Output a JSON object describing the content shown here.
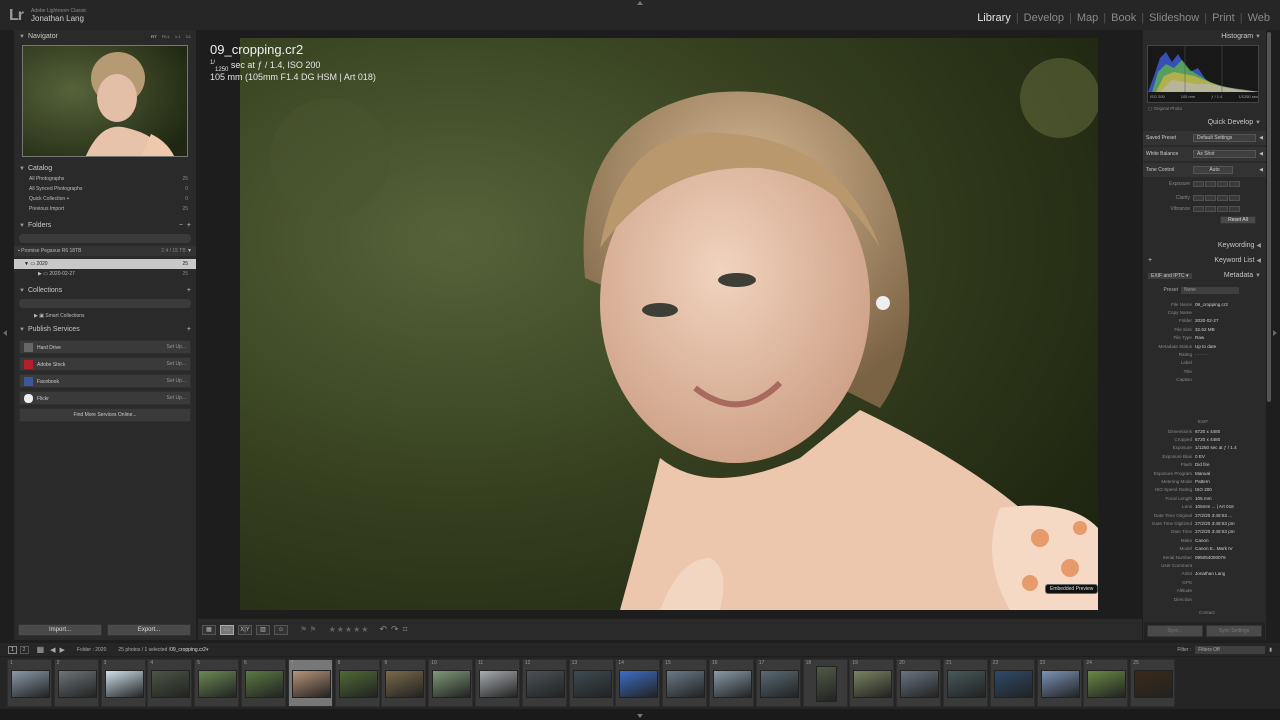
{
  "app": {
    "logo": "Lr",
    "product": "Adobe Lightroom Classic",
    "user": "Jonathan Lang"
  },
  "modules": [
    {
      "label": "Library",
      "active": true
    },
    {
      "label": "Develop",
      "active": false
    },
    {
      "label": "Map",
      "active": false
    },
    {
      "label": "Book",
      "active": false
    },
    {
      "label": "Slideshow",
      "active": false
    },
    {
      "label": "Print",
      "active": false
    },
    {
      "label": "Web",
      "active": false
    }
  ],
  "navigator": {
    "title": "Navigator",
    "modes": [
      "FIT",
      "FILL",
      "1:1",
      "3:1"
    ]
  },
  "catalog": {
    "title": "Catalog",
    "items": [
      {
        "label": "All Photographs",
        "count": "25"
      },
      {
        "label": "All Synced Photographs",
        "count": "0"
      },
      {
        "label": "Quick Collection +",
        "count": "0"
      },
      {
        "label": "Previous Import",
        "count": "25"
      }
    ]
  },
  "folders": {
    "title": "Folders",
    "volume": "Promise Pegasus R6 18TB",
    "volume_size": "2.4 / 15 TB",
    "items": [
      {
        "label": "2020",
        "count": "25"
      },
      {
        "label": "2020-02-27",
        "count": "25"
      }
    ]
  },
  "collections": {
    "title": "Collections",
    "items": [
      {
        "label": "Smart Collections"
      }
    ]
  },
  "publish": {
    "title": "Publish Services",
    "items": [
      {
        "label": "Hard Drive",
        "action": "Set Up..."
      },
      {
        "label": "Adobe Stock",
        "action": "Set Up..."
      },
      {
        "label": "Facebook",
        "action": "Set Up..."
      },
      {
        "label": "Flickr",
        "action": "Set Up..."
      }
    ],
    "find_more": "Find More Services Online..."
  },
  "buttons": {
    "import": "Import...",
    "export": "Export..."
  },
  "photo": {
    "filename": "09_cropping.cr2",
    "shutter_prefix": "1/",
    "shutter_den": "1250",
    "exposure_rest": " sec at ƒ / 1.4, ISO 200",
    "lens_line": "105 mm (105mm F1.4 DG HSM | Art 018)",
    "preview_badge": "Embedded Preview"
  },
  "histogram": {
    "title": "Histogram",
    "iso": "ISO 200",
    "focal": "105 mm",
    "aperture": "ƒ / 1.4",
    "shutter": "1/1250 sec",
    "original": "Original Photo"
  },
  "quick_develop": {
    "title": "Quick Develop",
    "saved_preset_label": "Saved Preset",
    "saved_preset_value": "Default Settings",
    "wb_label": "White Balance",
    "wb_value": "As Shot",
    "tone_label": "Tone Control",
    "tone_auto": "Auto",
    "exposure": "Exposure",
    "clarity": "Clarity",
    "vibrance": "Vibrance",
    "reset": "Reset All"
  },
  "keywording": "Keywording",
  "keyword_list": "Keyword List",
  "metadata": {
    "title": "Metadata",
    "set": "EXIF and IPTC",
    "preset_label": "Preset",
    "preset_value": "None",
    "file_fields": [
      {
        "k": "File Name",
        "v": "09_cropping.cr2"
      },
      {
        "k": "Copy Name",
        "v": ""
      },
      {
        "k": "Folder",
        "v": "2020-02-27"
      },
      {
        "k": "File Size",
        "v": "32.62 MB"
      },
      {
        "k": "File Type",
        "v": "Raw"
      },
      {
        "k": "Metadata Status",
        "v": "Up to date"
      },
      {
        "k": "Rating",
        "v": "· · · · ·"
      },
      {
        "k": "Label",
        "v": ""
      },
      {
        "k": "Title",
        "v": ""
      },
      {
        "k": "Caption",
        "v": ""
      }
    ],
    "exif_heading": "EXIF",
    "exif_fields": [
      {
        "k": "Dimensions",
        "v": "6720 x 4480"
      },
      {
        "k": "Cropped",
        "v": "6720 x 4480"
      },
      {
        "k": "Exposure",
        "v": "1/1250 sec at ƒ / 1.4"
      },
      {
        "k": "Exposure Bias",
        "v": "0 EV"
      },
      {
        "k": "Flash",
        "v": "Did fire"
      },
      {
        "k": "Exposure Program",
        "v": "Manual"
      },
      {
        "k": "Metering Mode",
        "v": "Pattern"
      },
      {
        "k": "ISO Speed Rating",
        "v": "ISO 200"
      },
      {
        "k": "Focal Length",
        "v": "105 mm"
      },
      {
        "k": "Lens",
        "v": "105mm ... | Art 018"
      },
      {
        "k": "Date Time Original",
        "v": "27/2/20 3:48:53 ..."
      },
      {
        "k": "Date Time Digitized",
        "v": "27/2/20 3:48:53 pm"
      },
      {
        "k": "Date Time",
        "v": "27/2/20 3:48:53 pm"
      },
      {
        "k": "Make",
        "v": "Canon"
      },
      {
        "k": "Model",
        "v": "Canon E...Mark IV"
      },
      {
        "k": "Serial Number",
        "v": "095054000076"
      },
      {
        "k": "User Comment",
        "v": ""
      },
      {
        "k": "Artist",
        "v": "Jonathan Lang"
      },
      {
        "k": "GPS",
        "v": ""
      },
      {
        "k": "Altitude",
        "v": ""
      },
      {
        "k": "Direction",
        "v": ""
      }
    ],
    "contact": "Contact"
  },
  "right_buttons": {
    "sync": "Sync...",
    "sync_settings": "Sync Settings"
  },
  "filmstrip": {
    "pages": [
      "1",
      "2"
    ],
    "folder_label": "Folder : 2020",
    "summary": "25 photos / 1 selected / ",
    "selected_file": "09_cropping.cr2",
    "filter_label": "Filter :",
    "filter_value": "Filters Off",
    "numbers": [
      "1",
      "2",
      "3",
      "4",
      "5",
      "6",
      "7",
      "8",
      "9",
      "10",
      "11",
      "12",
      "13",
      "14",
      "15",
      "16",
      "17",
      "18",
      "19",
      "20",
      "21",
      "22",
      "23",
      "24",
      "25"
    ]
  },
  "colors": {
    "accent": "#e6e6e6",
    "panel": "#2a2a2a",
    "background": "#1e1e1e"
  }
}
